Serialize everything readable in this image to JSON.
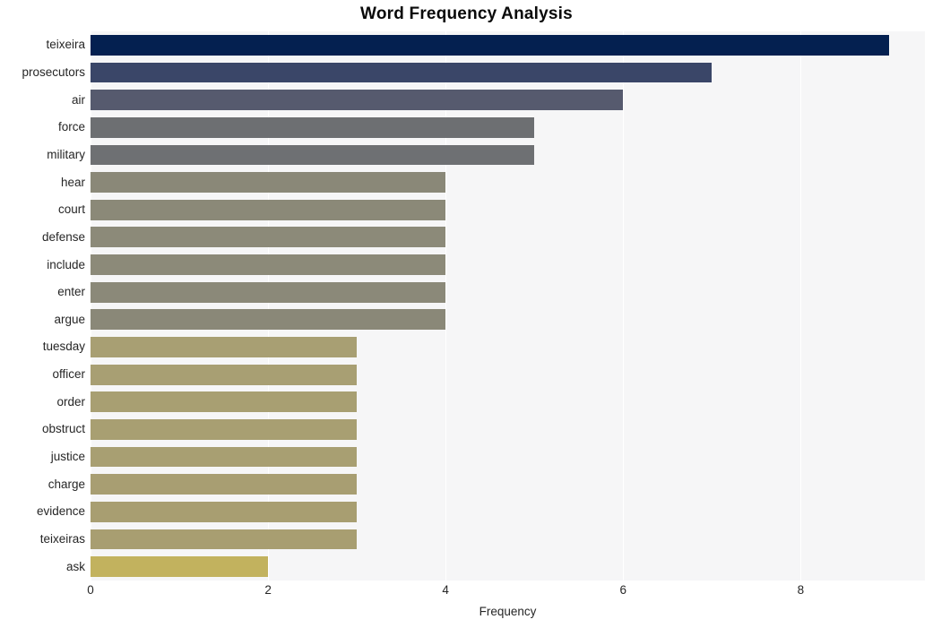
{
  "chart_data": {
    "type": "bar",
    "orientation": "horizontal",
    "title": "Word Frequency Analysis",
    "xlabel": "Frequency",
    "ylabel": "",
    "xlim": [
      0,
      9.4
    ],
    "xticks": [
      0,
      2,
      4,
      6,
      8
    ],
    "xtick_labels": [
      "0",
      "2",
      "4",
      "6",
      "8"
    ],
    "grid": true,
    "grid_axis": "x",
    "legend": "none",
    "plot_background": "#f6f6f7",
    "gridline_color": "#ffffff",
    "categories": [
      "teixeira",
      "prosecutors",
      "air",
      "force",
      "military",
      "hear",
      "court",
      "defense",
      "include",
      "enter",
      "argue",
      "tuesday",
      "officer",
      "order",
      "obstruct",
      "justice",
      "charge",
      "evidence",
      "teixeiras",
      "ask"
    ],
    "values": [
      9,
      7,
      6,
      5,
      5,
      4,
      4,
      4,
      4,
      4,
      4,
      3,
      3,
      3,
      3,
      3,
      3,
      3,
      3,
      2
    ],
    "bar_colors": [
      "#042050",
      "#3a4668",
      "#565a6e",
      "#6d6f72",
      "#6e7073",
      "#8a8878",
      "#8b8978",
      "#8c8a79",
      "#8c8a79",
      "#8b8979",
      "#8a8878",
      "#a89f73",
      "#a89f73",
      "#a89f72",
      "#a89f72",
      "#a89f72",
      "#a89e72",
      "#a89e71",
      "#a89e71",
      "#c2b25e"
    ],
    "series": [
      {
        "name": "Frequency",
        "values": [
          9,
          7,
          6,
          5,
          5,
          4,
          4,
          4,
          4,
          4,
          4,
          3,
          3,
          3,
          3,
          3,
          3,
          3,
          3,
          2
        ]
      }
    ]
  }
}
